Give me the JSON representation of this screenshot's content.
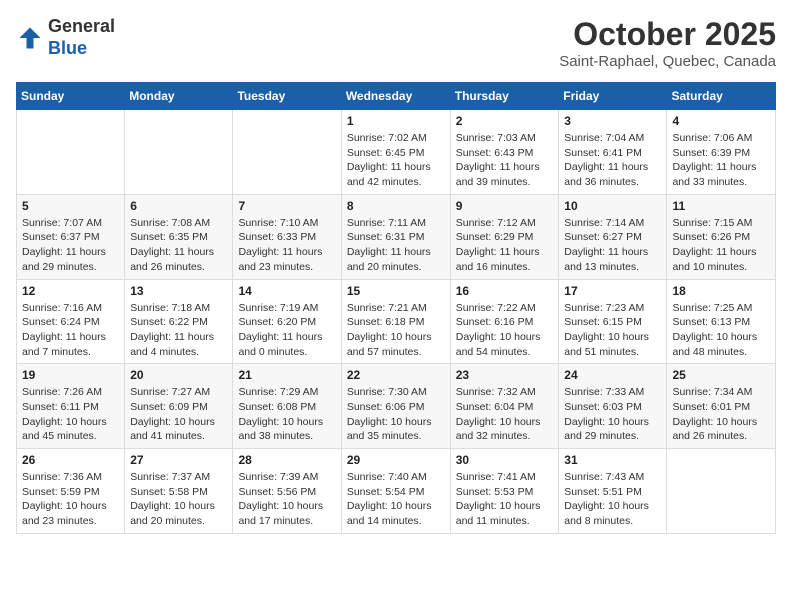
{
  "header": {
    "logo_line1": "General",
    "logo_line2": "Blue",
    "month": "October 2025",
    "location": "Saint-Raphael, Quebec, Canada"
  },
  "weekdays": [
    "Sunday",
    "Monday",
    "Tuesday",
    "Wednesday",
    "Thursday",
    "Friday",
    "Saturday"
  ],
  "weeks": [
    [
      {
        "day": "",
        "sunrise": "",
        "sunset": "",
        "daylight": ""
      },
      {
        "day": "",
        "sunrise": "",
        "sunset": "",
        "daylight": ""
      },
      {
        "day": "",
        "sunrise": "",
        "sunset": "",
        "daylight": ""
      },
      {
        "day": "1",
        "sunrise": "Sunrise: 7:02 AM",
        "sunset": "Sunset: 6:45 PM",
        "daylight": "Daylight: 11 hours and 42 minutes."
      },
      {
        "day": "2",
        "sunrise": "Sunrise: 7:03 AM",
        "sunset": "Sunset: 6:43 PM",
        "daylight": "Daylight: 11 hours and 39 minutes."
      },
      {
        "day": "3",
        "sunrise": "Sunrise: 7:04 AM",
        "sunset": "Sunset: 6:41 PM",
        "daylight": "Daylight: 11 hours and 36 minutes."
      },
      {
        "day": "4",
        "sunrise": "Sunrise: 7:06 AM",
        "sunset": "Sunset: 6:39 PM",
        "daylight": "Daylight: 11 hours and 33 minutes."
      }
    ],
    [
      {
        "day": "5",
        "sunrise": "Sunrise: 7:07 AM",
        "sunset": "Sunset: 6:37 PM",
        "daylight": "Daylight: 11 hours and 29 minutes."
      },
      {
        "day": "6",
        "sunrise": "Sunrise: 7:08 AM",
        "sunset": "Sunset: 6:35 PM",
        "daylight": "Daylight: 11 hours and 26 minutes."
      },
      {
        "day": "7",
        "sunrise": "Sunrise: 7:10 AM",
        "sunset": "Sunset: 6:33 PM",
        "daylight": "Daylight: 11 hours and 23 minutes."
      },
      {
        "day": "8",
        "sunrise": "Sunrise: 7:11 AM",
        "sunset": "Sunset: 6:31 PM",
        "daylight": "Daylight: 11 hours and 20 minutes."
      },
      {
        "day": "9",
        "sunrise": "Sunrise: 7:12 AM",
        "sunset": "Sunset: 6:29 PM",
        "daylight": "Daylight: 11 hours and 16 minutes."
      },
      {
        "day": "10",
        "sunrise": "Sunrise: 7:14 AM",
        "sunset": "Sunset: 6:27 PM",
        "daylight": "Daylight: 11 hours and 13 minutes."
      },
      {
        "day": "11",
        "sunrise": "Sunrise: 7:15 AM",
        "sunset": "Sunset: 6:26 PM",
        "daylight": "Daylight: 11 hours and 10 minutes."
      }
    ],
    [
      {
        "day": "12",
        "sunrise": "Sunrise: 7:16 AM",
        "sunset": "Sunset: 6:24 PM",
        "daylight": "Daylight: 11 hours and 7 minutes."
      },
      {
        "day": "13",
        "sunrise": "Sunrise: 7:18 AM",
        "sunset": "Sunset: 6:22 PM",
        "daylight": "Daylight: 11 hours and 4 minutes."
      },
      {
        "day": "14",
        "sunrise": "Sunrise: 7:19 AM",
        "sunset": "Sunset: 6:20 PM",
        "daylight": "Daylight: 11 hours and 0 minutes."
      },
      {
        "day": "15",
        "sunrise": "Sunrise: 7:21 AM",
        "sunset": "Sunset: 6:18 PM",
        "daylight": "Daylight: 10 hours and 57 minutes."
      },
      {
        "day": "16",
        "sunrise": "Sunrise: 7:22 AM",
        "sunset": "Sunset: 6:16 PM",
        "daylight": "Daylight: 10 hours and 54 minutes."
      },
      {
        "day": "17",
        "sunrise": "Sunrise: 7:23 AM",
        "sunset": "Sunset: 6:15 PM",
        "daylight": "Daylight: 10 hours and 51 minutes."
      },
      {
        "day": "18",
        "sunrise": "Sunrise: 7:25 AM",
        "sunset": "Sunset: 6:13 PM",
        "daylight": "Daylight: 10 hours and 48 minutes."
      }
    ],
    [
      {
        "day": "19",
        "sunrise": "Sunrise: 7:26 AM",
        "sunset": "Sunset: 6:11 PM",
        "daylight": "Daylight: 10 hours and 45 minutes."
      },
      {
        "day": "20",
        "sunrise": "Sunrise: 7:27 AM",
        "sunset": "Sunset: 6:09 PM",
        "daylight": "Daylight: 10 hours and 41 minutes."
      },
      {
        "day": "21",
        "sunrise": "Sunrise: 7:29 AM",
        "sunset": "Sunset: 6:08 PM",
        "daylight": "Daylight: 10 hours and 38 minutes."
      },
      {
        "day": "22",
        "sunrise": "Sunrise: 7:30 AM",
        "sunset": "Sunset: 6:06 PM",
        "daylight": "Daylight: 10 hours and 35 minutes."
      },
      {
        "day": "23",
        "sunrise": "Sunrise: 7:32 AM",
        "sunset": "Sunset: 6:04 PM",
        "daylight": "Daylight: 10 hours and 32 minutes."
      },
      {
        "day": "24",
        "sunrise": "Sunrise: 7:33 AM",
        "sunset": "Sunset: 6:03 PM",
        "daylight": "Daylight: 10 hours and 29 minutes."
      },
      {
        "day": "25",
        "sunrise": "Sunrise: 7:34 AM",
        "sunset": "Sunset: 6:01 PM",
        "daylight": "Daylight: 10 hours and 26 minutes."
      }
    ],
    [
      {
        "day": "26",
        "sunrise": "Sunrise: 7:36 AM",
        "sunset": "Sunset: 5:59 PM",
        "daylight": "Daylight: 10 hours and 23 minutes."
      },
      {
        "day": "27",
        "sunrise": "Sunrise: 7:37 AM",
        "sunset": "Sunset: 5:58 PM",
        "daylight": "Daylight: 10 hours and 20 minutes."
      },
      {
        "day": "28",
        "sunrise": "Sunrise: 7:39 AM",
        "sunset": "Sunset: 5:56 PM",
        "daylight": "Daylight: 10 hours and 17 minutes."
      },
      {
        "day": "29",
        "sunrise": "Sunrise: 7:40 AM",
        "sunset": "Sunset: 5:54 PM",
        "daylight": "Daylight: 10 hours and 14 minutes."
      },
      {
        "day": "30",
        "sunrise": "Sunrise: 7:41 AM",
        "sunset": "Sunset: 5:53 PM",
        "daylight": "Daylight: 10 hours and 11 minutes."
      },
      {
        "day": "31",
        "sunrise": "Sunrise: 7:43 AM",
        "sunset": "Sunset: 5:51 PM",
        "daylight": "Daylight: 10 hours and 8 minutes."
      },
      {
        "day": "",
        "sunrise": "",
        "sunset": "",
        "daylight": ""
      }
    ]
  ]
}
